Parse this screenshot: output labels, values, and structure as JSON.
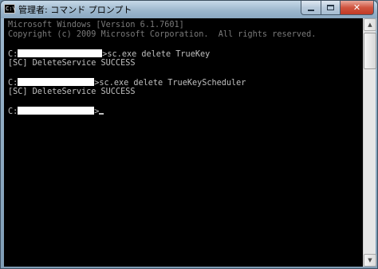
{
  "window": {
    "title": "管理者: コマンド プロンプト",
    "icon_label": "C:\\"
  },
  "controls": {
    "close_glyph": "✕"
  },
  "console": {
    "header_lines": [
      "Microsoft Windows [Version 6.1.7601]",
      "Copyright (c) 2009 Microsoft Corporation.  All rights reserved."
    ],
    "prompt_drive": "C:",
    "prompt_suffix": ">",
    "commands": [
      "sc.exe delete TrueKey",
      "sc.exe delete TrueKeyScheduler"
    ],
    "results": [
      "[SC] DeleteService SUCCESS",
      "[SC] DeleteService SUCCESS"
    ]
  },
  "scrollbar": {
    "up_glyph": "▲",
    "down_glyph": "▼"
  }
}
